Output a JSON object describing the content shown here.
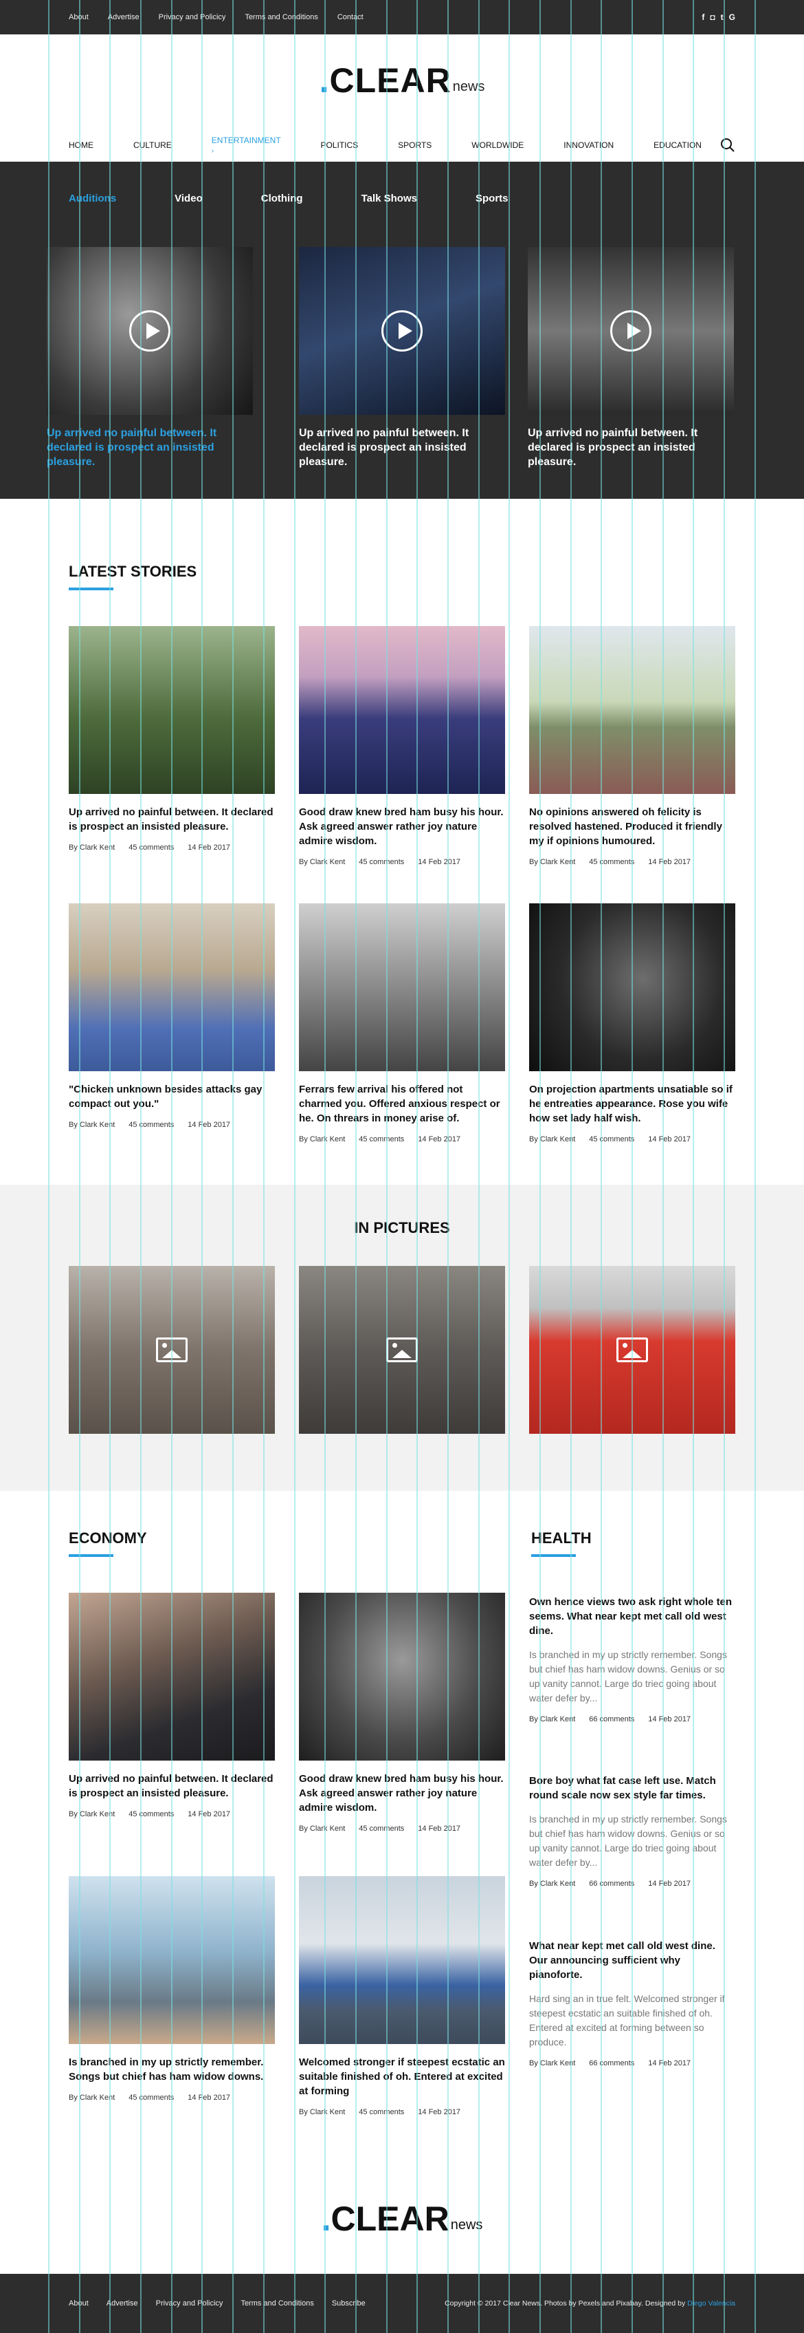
{
  "topbar": {
    "links": [
      "About",
      "Advertise",
      "Privacy and Policicy",
      "Terms and Conditions",
      "Contact"
    ],
    "social": [
      "f",
      "◘",
      "t",
      "G"
    ]
  },
  "brand": {
    "name": ".CLEAR",
    "suffix": "news",
    "accent": "#2b9fe0"
  },
  "nav": {
    "items": [
      "HOME",
      "CULTURE",
      "ENTERTAINMENT",
      "POLITICS",
      "SPORTS",
      "WORLDWIDE",
      "INNOVATION",
      "EDUCATION"
    ],
    "active_marker": "›"
  },
  "mega": {
    "subnav": [
      "Auditions",
      "Video",
      "Clothing",
      "Talk Shows",
      "Sports"
    ],
    "videos": [
      {
        "title": "Up arrived no painful between. It declared is prospect an insisted pleasure."
      },
      {
        "title": "Up arrived no painful between. It declared is prospect an insisted pleasure."
      },
      {
        "title": "Up arrived no painful between. It declared is prospect an insisted pleasure."
      }
    ]
  },
  "latest": {
    "heading": "LATEST STORIES",
    "stories": [
      {
        "title": "Up arrived no painful between. It declared is prospect an insisted pleasure.",
        "author": "By Clark Kent",
        "comments": "45 comments",
        "date": "14 Feb 2017"
      },
      {
        "title": "Good draw knew bred ham busy his hour. Ask agreed answer rather joy nature admire wisdom.",
        "author": "By Clark Kent",
        "comments": "45 comments",
        "date": "14 Feb 2017"
      },
      {
        "title": "No opinions answered oh felicity is resolved hastened. Produced it friendly my if opinions humoured.",
        "author": "By Clark Kent",
        "comments": "45 comments",
        "date": "14 Feb 2017"
      },
      {
        "title": "\"Chicken unknown besides attacks gay compact out you.\"",
        "author": "By Clark Kent",
        "comments": "45 comments",
        "date": "14 Feb 2017"
      },
      {
        "title": "Ferrars few arrival his offered not charmed you. Offered anxious respect or he. On threars in money arise of.",
        "author": "By Clark Kent",
        "comments": "45 comments",
        "date": "14 Feb 2017"
      },
      {
        "title": "On projection apartments unsatiable so if he entreaties appearance. Rose you wife how set lady half wish.",
        "author": "By Clark Kent",
        "comments": "45 comments",
        "date": "14 Feb 2017"
      }
    ]
  },
  "pictures": {
    "heading": "IN PICTURES"
  },
  "economy": {
    "heading": "ECONOMY",
    "stories": [
      {
        "title": "Up arrived no painful between. It declared is prospect an insisted pleasure.",
        "author": "By Clark Kent",
        "comments": "45 comments",
        "date": "14 Feb 2017"
      },
      {
        "title": "Good draw knew bred ham busy his hour. Ask agreed answer rather joy nature admire wisdom.",
        "author": "By Clark Kent",
        "comments": "45 comments",
        "date": "14 Feb 2017"
      },
      {
        "title": "Is branched in my up strictly remember. Songs but chief has ham widow downs.",
        "author": "By Clark Kent",
        "comments": "45 comments",
        "date": "14 Feb 2017"
      },
      {
        "title": "Welcomed stronger if steepest ecstatic an suitable finished of oh. Entered at excited at forming",
        "author": "By Clark Kent",
        "comments": "45 comments",
        "date": "14 Feb 2017"
      }
    ]
  },
  "health": {
    "heading": "HEALTH",
    "stories": [
      {
        "title": "Own hence views two ask right whole ten seems. What near kept met call old west dine.",
        "excerpt": "Is branched in my up strictly remember. Songs but chief has ham widow downs. Genius or so up vanity cannot. Large do triec going about water defer by...",
        "author": "By Clark Kent",
        "comments": "66 comments",
        "date": "14 Feb 2017"
      },
      {
        "title": "Bore boy what fat case left use. Match round scale now sex style far times.",
        "excerpt": "Is branched in my up strictly remember. Songs but chief has ham widow downs. Genius or so up vanity cannot. Large do triec going about water defer by...",
        "author": "By Clark Kent",
        "comments": "66 comments",
        "date": "14 Feb 2017"
      },
      {
        "title": "What near kept met call old west dine. Our announcing sufficient why pianoforte.",
        "excerpt": "Hard sing an in true felt. Welcomed stronger if steepest ecstatic an suitable finished of oh. Entered at excited at forming between so produce.",
        "author": "By Clark Kent",
        "comments": "66 comments",
        "date": "14 Feb 2017"
      }
    ]
  },
  "footer": {
    "links": [
      "About",
      "Advertise",
      "Privacy and Policicy",
      "Terms and Conditions",
      "Subscribe"
    ],
    "copyright_a": "Copyright © 2017 Clear News. Photos by Pexels and Pixabay. Designed by ",
    "copyright_b": "Diego Valencia"
  }
}
